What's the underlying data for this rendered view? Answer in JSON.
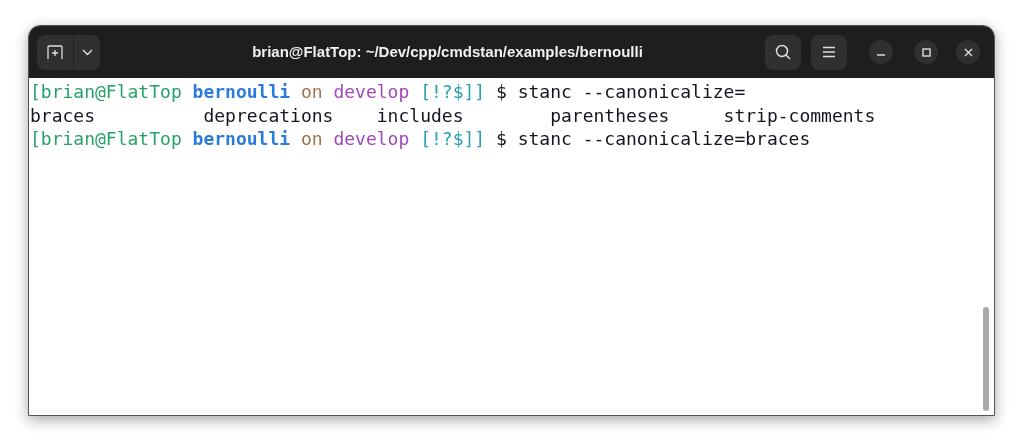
{
  "window": {
    "title": "brian@FlatTop: ~/Dev/cpp/cmdstan/examples/bernoulli"
  },
  "terminal": {
    "lines": [
      {
        "kind": "prompt",
        "segments": [
          {
            "kind": "user",
            "text": "[brian@FlatTop"
          },
          {
            "kind": "directory",
            "text": "bernoulli"
          },
          {
            "kind": "word",
            "text": "on"
          },
          {
            "kind": "branch",
            "text": "develop"
          },
          {
            "kind": "status",
            "text": "[!?$]]"
          },
          {
            "kind": "command",
            "text": "$ stanc --canonicalize="
          }
        ]
      },
      {
        "kind": "completions",
        "items": [
          "braces",
          "deprecations",
          "includes",
          "parentheses",
          "strip-comments"
        ]
      },
      {
        "kind": "prompt",
        "segments": [
          {
            "kind": "user",
            "text": "[brian@FlatTop"
          },
          {
            "kind": "directory",
            "text": "bernoulli"
          },
          {
            "kind": "word",
            "text": "on"
          },
          {
            "kind": "branch",
            "text": "develop"
          },
          {
            "kind": "status",
            "text": "[!?$]]"
          },
          {
            "kind": "command",
            "text": "$ stanc --canonicalize=braces"
          }
        ]
      }
    ]
  }
}
